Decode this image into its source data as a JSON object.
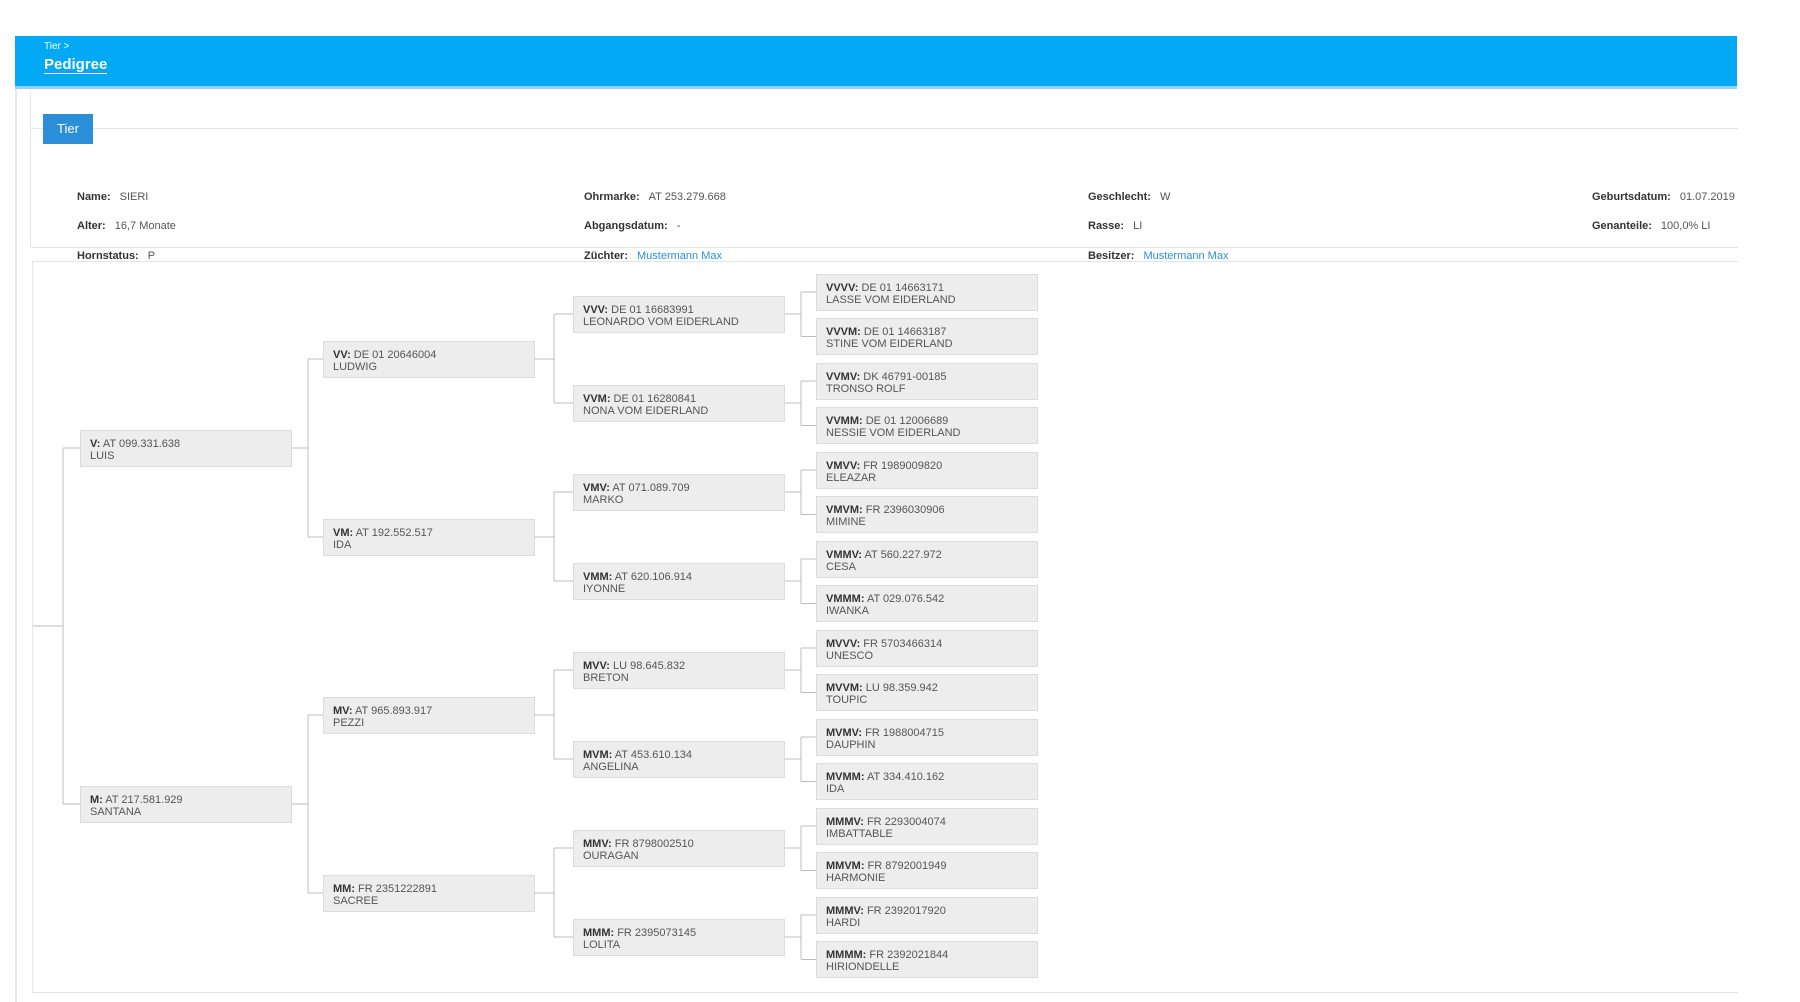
{
  "header": {
    "breadcrumb": "Tier >",
    "title": "Pedigree"
  },
  "tab": {
    "label": "Tier"
  },
  "animal": {
    "name": {
      "label": "Name:",
      "value": "SIERI"
    },
    "alter": {
      "label": "Alter:",
      "value": "16,7 Monate"
    },
    "hornstatus": {
      "label": "Hornstatus:",
      "value": "P"
    },
    "ohrmarke": {
      "label": "Ohrmarke:",
      "value": "AT 253.279.668"
    },
    "abgangsdatum": {
      "label": "Abgangsdatum:",
      "value": "-"
    },
    "zuechter": {
      "label": "Züchter:",
      "value": "Mustermann Max"
    },
    "geschlecht": {
      "label": "Geschlecht:",
      "value": "W"
    },
    "rasse": {
      "label": "Rasse:",
      "value": "LI"
    },
    "besitzer": {
      "label": "Besitzer:",
      "value": "Mustermann Max"
    },
    "geburtsdatum": {
      "label": "Geburtsdatum:",
      "value": "01.07.2019"
    },
    "genanteile": {
      "label": "Genanteile:",
      "value": "100,0% LI"
    }
  },
  "pedigree": {
    "gen1": [
      {
        "code": "V:",
        "id": "AT 099.331.638",
        "name": "LUIS"
      },
      {
        "code": "M:",
        "id": "AT 217.581.929",
        "name": "SANTANA"
      }
    ],
    "gen2": [
      {
        "code": "VV:",
        "id": "DE 01 20646004",
        "name": "LUDWIG"
      },
      {
        "code": "VM:",
        "id": "AT 192.552.517",
        "name": "IDA"
      },
      {
        "code": "MV:",
        "id": "AT 965.893.917",
        "name": "PEZZI"
      },
      {
        "code": "MM:",
        "id": "FR 2351222891",
        "name": "SACREE"
      }
    ],
    "gen3": [
      {
        "code": "VVV:",
        "id": "DE 01 16683991",
        "name": "LEONARDO VOM EIDERLAND"
      },
      {
        "code": "VVM:",
        "id": "DE 01 16280841",
        "name": "NONA VOM EIDERLAND"
      },
      {
        "code": "VMV:",
        "id": "AT 071.089.709",
        "name": "MARKO"
      },
      {
        "code": "VMM:",
        "id": "AT 620.106.914",
        "name": "IYONNE"
      },
      {
        "code": "MVV:",
        "id": "LU 98.645.832",
        "name": "BRETON"
      },
      {
        "code": "MVM:",
        "id": "AT 453.610.134",
        "name": "ANGELINA"
      },
      {
        "code": "MMV:",
        "id": "FR 8798002510",
        "name": "OURAGAN"
      },
      {
        "code": "MMM:",
        "id": "FR 2395073145",
        "name": "LOLITA"
      }
    ],
    "gen4": [
      {
        "code": "VVVV:",
        "id": "DE 01 14663171",
        "name": "LASSE VOM EIDERLAND"
      },
      {
        "code": "VVVM:",
        "id": "DE 01 14663187",
        "name": "STINE VOM EIDERLAND"
      },
      {
        "code": "VVMV:",
        "id": "DK 46791-00185",
        "name": "TRONSO ROLF"
      },
      {
        "code": "VVMM:",
        "id": "DE 01 12006689",
        "name": "NESSIE VOM EIDERLAND"
      },
      {
        "code": "VMVV:",
        "id": "FR 1989009820",
        "name": "ELEAZAR"
      },
      {
        "code": "VMVM:",
        "id": "FR 2396030906",
        "name": "MIMINE"
      },
      {
        "code": "VMMV:",
        "id": "AT 560.227.972",
        "name": "CESA"
      },
      {
        "code": "VMMM:",
        "id": "AT 029.076.542",
        "name": "IWANKA"
      },
      {
        "code": "MVVV:",
        "id": "FR 5703466314",
        "name": "UNESCO"
      },
      {
        "code": "MVVM:",
        "id": "LU 98.359.942",
        "name": "TOUPIC"
      },
      {
        "code": "MVMV:",
        "id": "FR 1988004715",
        "name": "DAUPHIN"
      },
      {
        "code": "MVMM:",
        "id": "AT 334.410.162",
        "name": "IDA"
      },
      {
        "code": "MMMV:",
        "id": "FR 2293004074",
        "name": "IMBATTABLE"
      },
      {
        "code": "MMVM:",
        "id": "FR 8792001949",
        "name": "HARMONIE"
      },
      {
        "code": "MMMV:",
        "id": "FR 2392017920",
        "name": "HARDI"
      },
      {
        "code": "MMMM:",
        "id": "FR 2392021844",
        "name": "HIRIONDELLE"
      }
    ]
  },
  "colors": {
    "header": "#03a9f4",
    "tab": "#2a8fd8",
    "link": "#2a8fd8",
    "node": "#ededed"
  }
}
